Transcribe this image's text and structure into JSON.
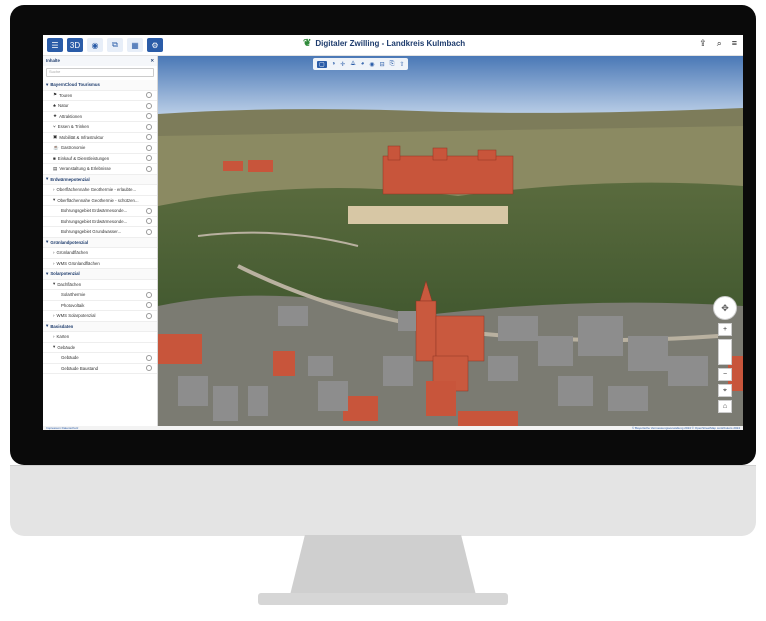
{
  "app": {
    "title": "Digitaler Zwilling - Landkreis Kulmbach"
  },
  "header": {
    "left_buttons": [
      "layers",
      "3D",
      "globe",
      "split",
      "grid",
      "settings"
    ],
    "right_icons": [
      "share-icon",
      "search-icon",
      "menu-icon"
    ]
  },
  "sidebar": {
    "title": "Inhalte",
    "search_placeholder": "Suche",
    "groups": [
      {
        "label": "BayernCloud Tourismus",
        "items": [
          "Touren",
          "Natur",
          "Attraktionen",
          "Essen & Trinken",
          "Mobilität & Infrastruktur",
          "Gastronomie",
          "Einkauf & Dienstleistungen",
          "Veranstaltung & Erlebnisse"
        ]
      },
      {
        "label": "Erdwärmepotenzial",
        "items": [
          "Oberflächennahe Geothermie - erlaubte...",
          "Oberflächennahe Geothermie - schützen...",
          "Bohrungsgebiet Erdwärmesonde...",
          "Bohrungsgebiet Erdwärmesonde...",
          "Bohrungsgebiet Grundwasser..."
        ]
      },
      {
        "label": "Grünlandpotenzial",
        "items": [
          "Grünlandflächen",
          "WMS Grünlandflächen"
        ]
      },
      {
        "label": "Solarpotenzial",
        "items": [
          "Dachflächen",
          "Solarthermie",
          "Photovoltaik",
          "WMS Solarpotenzial"
        ]
      },
      {
        "label": "Basisdaten",
        "items": [
          "Karten",
          "Gebäude",
          "Gebäude",
          "Gebäude Baustand"
        ]
      }
    ]
  },
  "map": {
    "toolbar": [
      "select",
      "layers",
      "measure",
      "draw",
      "view",
      "eye",
      "grid",
      "export",
      "share"
    ],
    "nav_controls": [
      "compass",
      "zoom-in",
      "zoom-out",
      "location",
      "home"
    ]
  },
  "statusbar": {
    "left": "Impressum  Datenschutz",
    "right": "© Bayerische Vermessungsverwaltung 2024  © OpenStreetMap contributors 2024"
  }
}
